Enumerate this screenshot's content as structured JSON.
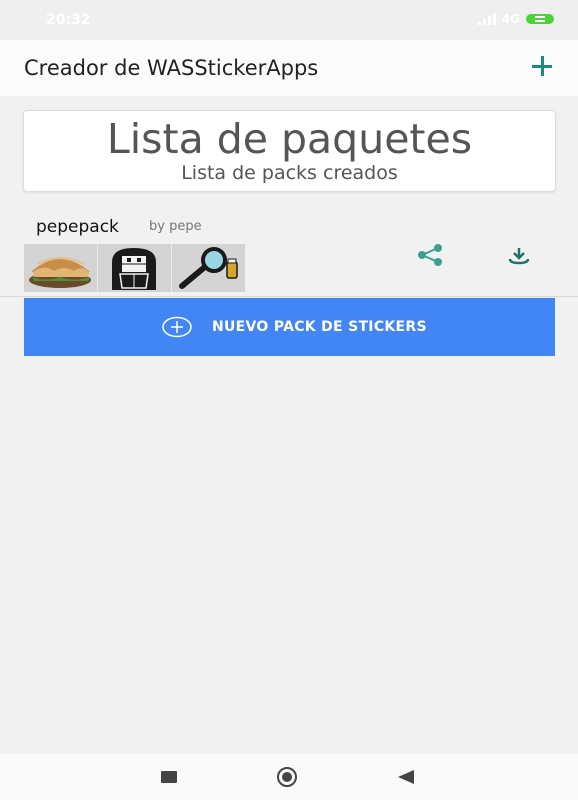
{
  "status_bar": {
    "time": "20:32",
    "network": "4G",
    "battery_color": "#4cd137"
  },
  "app_bar": {
    "title": "Creador de WASStickerApps",
    "add_icon": "plus-icon",
    "accent_color": "#1e8a7a"
  },
  "header": {
    "title": "Lista de paquetes",
    "subtitle": "Lista de packs creados"
  },
  "packs": [
    {
      "name": "pepepack",
      "author": "by pepe",
      "stickers": [
        "burger-sticker",
        "cartoon-figure-sticker",
        "magnifier-sticker"
      ],
      "share_icon": "share-icon",
      "download_icon": "download-icon"
    }
  ],
  "new_pack_button": {
    "label": "NUEVO PACK DE STICKERS",
    "icon": "add-circle-icon",
    "color": "#4285f4"
  },
  "nav_bar": {
    "recent_icon": "recent-apps-icon",
    "home_icon": "home-icon",
    "back_icon": "back-icon"
  }
}
